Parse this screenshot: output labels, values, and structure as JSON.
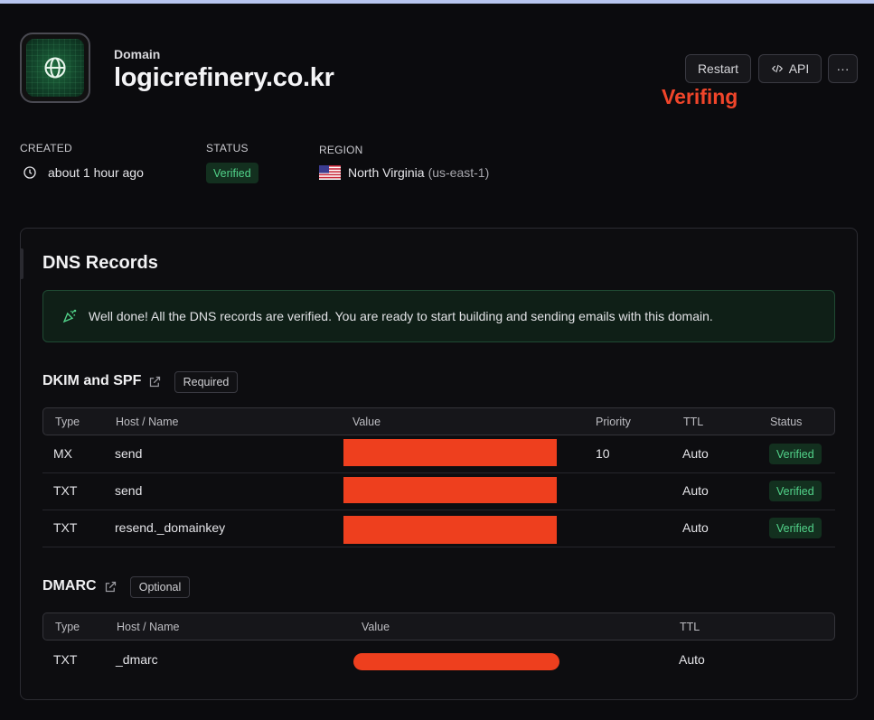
{
  "header": {
    "eyebrow": "Domain",
    "title": "logicrefinery.co.kr",
    "actions": {
      "restart": "Restart",
      "api": "API",
      "more": "···"
    },
    "annotation": "Verifing"
  },
  "meta": {
    "created_label": "CREATED",
    "created_value": "about 1 hour ago",
    "status_label": "STATUS",
    "status_value": "Verified",
    "region_label": "REGION",
    "region_name": "North Virginia",
    "region_code": "(us-east-1)"
  },
  "dns": {
    "title": "DNS Records",
    "alert": "Well done! All the DNS records are verified. You are ready to start building and sending emails with this domain.",
    "dkim": {
      "title": "DKIM and SPF",
      "tag": "Required",
      "columns": [
        "Type",
        "Host / Name",
        "Value",
        "Priority",
        "TTL",
        "Status"
      ],
      "rows": [
        {
          "type": "MX",
          "host": "send",
          "priority": "10",
          "ttl": "Auto",
          "status": "Verified"
        },
        {
          "type": "TXT",
          "host": "send",
          "priority": "",
          "ttl": "Auto",
          "status": "Verified"
        },
        {
          "type": "TXT",
          "host": "resend._domainkey",
          "priority": "",
          "ttl": "Auto",
          "status": "Verified"
        }
      ]
    },
    "dmarc": {
      "title": "DMARC",
      "tag": "Optional",
      "columns": [
        "Type",
        "Host / Name",
        "Value",
        "TTL"
      ],
      "rows": [
        {
          "type": "TXT",
          "host": "_dmarc",
          "ttl": "Auto"
        }
      ]
    }
  },
  "colors": {
    "accent_red": "#f0452a",
    "verified_green": "#52d38a",
    "redaction": "#ee3f1e"
  }
}
